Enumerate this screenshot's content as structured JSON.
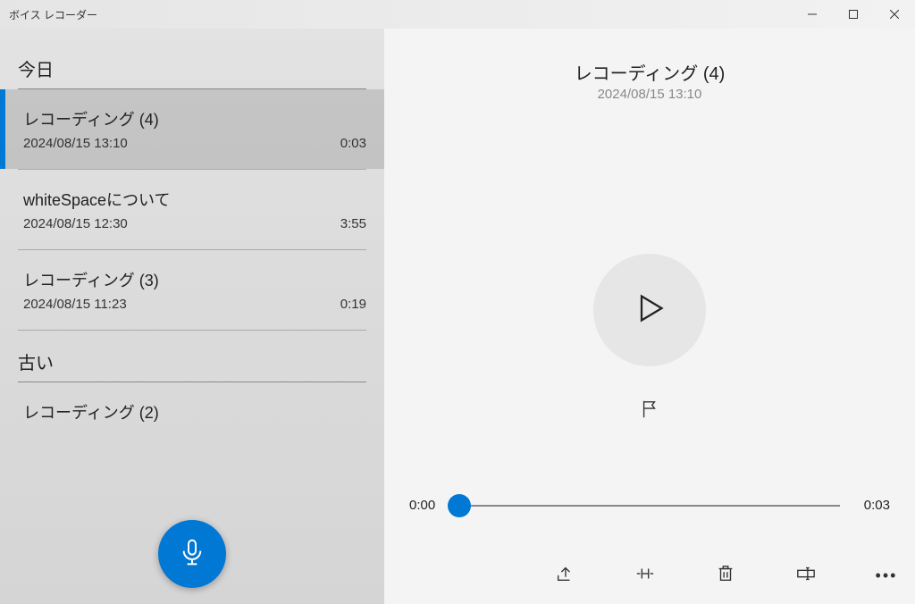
{
  "window": {
    "title": "ボイス レコーダー"
  },
  "sidebar": {
    "sections": [
      {
        "label": "今日"
      },
      {
        "label": "古い"
      }
    ],
    "recordings": [
      {
        "title": "レコーディング (4)",
        "date": "2024/08/15 13:10",
        "duration": "0:03",
        "selected": true
      },
      {
        "title": "whiteSpaceについて",
        "date": "2024/08/15 12:30",
        "duration": "3:55",
        "selected": false
      },
      {
        "title": "レコーディング (3)",
        "date": "2024/08/15 11:23",
        "duration": "0:19",
        "selected": false
      },
      {
        "title": "レコーディング (2)",
        "date": "",
        "duration": "",
        "selected": false
      }
    ]
  },
  "detail": {
    "title": "レコーディング (4)",
    "date": "2024/08/15 13:10",
    "currentTime": "0:00",
    "totalTime": "0:03"
  }
}
